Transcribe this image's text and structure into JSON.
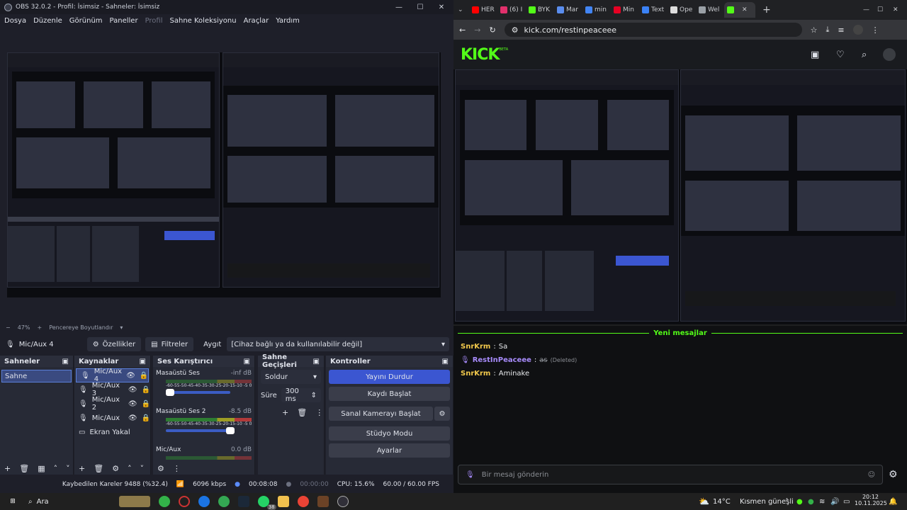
{
  "obs": {
    "title": "OBS 32.0.2 - Profil: İsimsiz - Sahneler: İsimsiz",
    "window_controls": [
      "—",
      "☐",
      "✕"
    ],
    "menu": [
      "Dosya",
      "Düzenle",
      "Görünüm",
      "Paneller",
      "Profil",
      "Sahne Koleksiyonu",
      "Araçlar",
      "Yardım"
    ],
    "menu_disabled": "Profil",
    "preview_bar": {
      "minus": "−",
      "zoom": "47%",
      "plus": "+",
      "fit": "Pencereye Boyutlandır",
      "chev": "▾"
    },
    "source_bar": {
      "source": "Mic/Aux 4",
      "props": "Özellikler",
      "filters": "Filtreler",
      "device_label": "Aygıt",
      "device_value": "[Cihaz bağlı ya da kullanılabilir değil]"
    },
    "scenes": {
      "title": "Sahneler",
      "items": [
        "Sahne"
      ]
    },
    "sources": {
      "title": "Kaynaklar",
      "items": [
        "Mic/Aux 4",
        "Mic/Aux 3",
        "Mic/Aux 2",
        "Mic/Aux",
        "Ekran Yakal"
      ]
    },
    "mixer": {
      "title": "Ses Karıştırıcı",
      "channels": [
        {
          "name": "Masaüstü Ses",
          "db": "-inf dB",
          "level": 0
        },
        {
          "name": "Masaüstü Ses 2",
          "db": "-8.5 dB",
          "level": 0.85
        },
        {
          "name": "Mic/Aux",
          "db": "0.0 dB",
          "level": 0
        }
      ],
      "ticks": "-60-55-50-45-40-35-30-25-20-15-10 -5 0"
    },
    "transitions": {
      "title": "Sahne Geçişleri",
      "type": "Soldur",
      "duration_label": "Süre",
      "duration": "300 ms"
    },
    "controls": {
      "title": "Kontroller",
      "stream": "Yayını Durdur",
      "record": "Kaydı Başlat",
      "vcam": "Sanal Kamerayı Başlat",
      "studio": "Stüdyo Modu",
      "settings": "Ayarlar"
    },
    "status": {
      "dropped": "Kaybedilen Kareler 9488 (%32.4)",
      "bitrate": "6096 kbps",
      "stream_time": "00:08:08",
      "rec_time": "00:00:00",
      "cpu": "CPU: 15.6%",
      "fps": "60.00 / 60.00 FPS"
    }
  },
  "chrome": {
    "tabs": [
      {
        "label": "HER",
        "color": "#ff0000"
      },
      {
        "label": "(6) I",
        "color": "#e1306c"
      },
      {
        "label": "BYK",
        "color": "#53fc18"
      },
      {
        "label": "Mar",
        "color": "#5a8dee"
      },
      {
        "label": "min",
        "color": "#4285f4"
      },
      {
        "label": "Min",
        "color": "#e60023"
      },
      {
        "label": "Text",
        "color": "#3b82f6"
      },
      {
        "label": "Ope",
        "color": "#dddddd"
      },
      {
        "label": "Wel",
        "color": "#9aa0a6"
      }
    ],
    "active_tab_color": "#53fc18",
    "url": "kick.com/restinpeaceee",
    "kick_logo": "KICK",
    "kick_beta": "BETA",
    "chat": {
      "divider": "Yeni mesajlar",
      "messages": [
        {
          "user": "SnrKrm",
          "text": "Sa"
        },
        {
          "user": "RestInPeaceee",
          "text": "as",
          "note": "(Deleted)"
        },
        {
          "user": "SnrKrm",
          "text": "Aminake"
        }
      ],
      "placeholder": "Bir mesaj gönderin"
    }
  },
  "taskbar": {
    "search": "Ara",
    "badge": "38",
    "weather": "14°C",
    "weather_desc": "Kısmen güneşli",
    "time": "20:12",
    "date": "10.11.2025"
  }
}
